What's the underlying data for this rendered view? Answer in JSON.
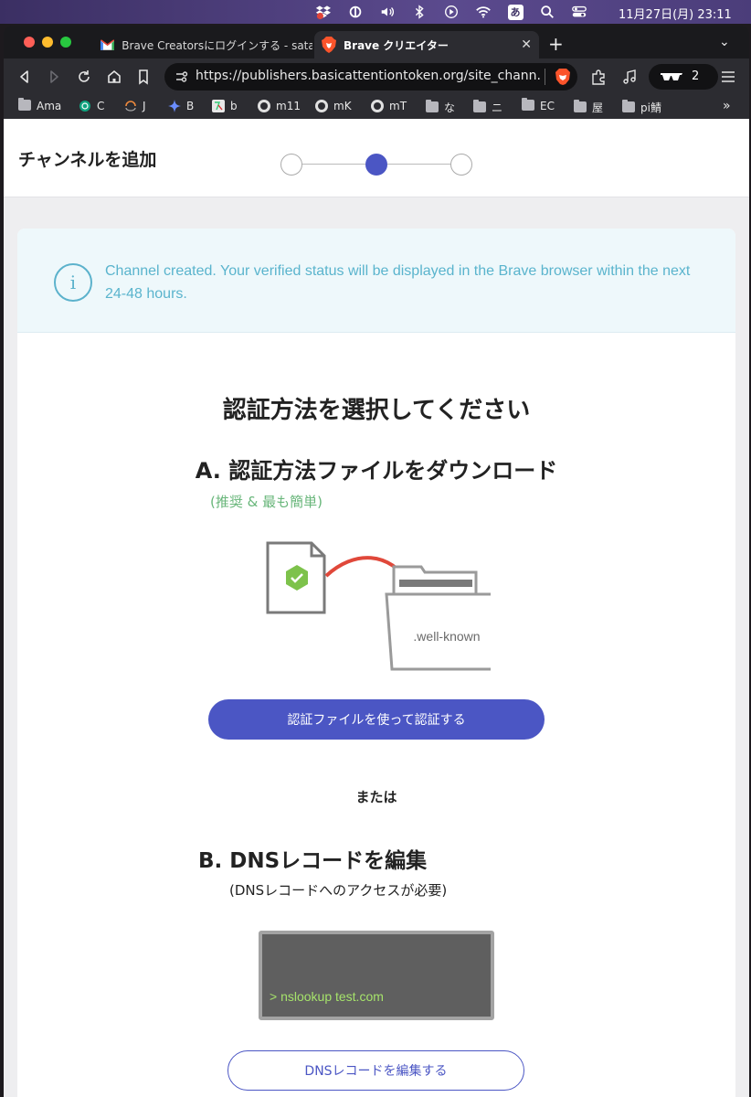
{
  "menubar": {
    "input_indicator": "あ",
    "datetime": "11月27日(月)  23:11",
    "icons": [
      "dropbox-icon",
      "1password-icon",
      "volume-icon",
      "bluetooth-icon",
      "play-icon",
      "wifi-icon",
      "input-method-icon",
      "spotlight-icon",
      "control-center-icon"
    ]
  },
  "browser": {
    "tabs": [
      {
        "title": "Brave Creatorsにログインする - satak",
        "favicon": "gmail-icon",
        "active": false
      },
      {
        "title": "Brave クリエイター",
        "favicon": "brave-icon",
        "active": true
      }
    ],
    "new_tab": "+",
    "url": "https://publishers.basicattentiontoken.org/site_chann...",
    "tor_count": "2",
    "bookmarks": [
      {
        "label": "Ama",
        "icon": "folder-icon"
      },
      {
        "label": "C",
        "icon": "chatgpt-icon"
      },
      {
        "label": "J",
        "icon": "ring-icon"
      },
      {
        "label": "B",
        "icon": "gemini-icon"
      },
      {
        "label": "b",
        "icon": "translate-icon"
      },
      {
        "label": "m11",
        "icon": "globe-icon"
      },
      {
        "label": "mK",
        "icon": "globe-icon"
      },
      {
        "label": "mT",
        "icon": "globe-icon"
      },
      {
        "label": "な",
        "icon": "folder-icon"
      },
      {
        "label": "ニ",
        "icon": "folder-icon"
      },
      {
        "label": "EC",
        "icon": "folder-icon"
      },
      {
        "label": "屋",
        "icon": "folder-icon"
      },
      {
        "label": "pi鯖",
        "icon": "folder-icon"
      }
    ],
    "bookmarks_more": "»"
  },
  "page": {
    "title": "チャンネルを追加",
    "steps_total": 3,
    "current_step": 2,
    "alert": "Channel created. Your verified status will be displayed in the Brave browser within the next 24-48 hours.",
    "heading": "認証方法を選択してください",
    "option_a": {
      "title": "A.  認証方法ファイルをダウンロード",
      "subtitle": "(推奨 & 最も簡単)",
      "folder_label": ".well-known",
      "button": "認証ファイルを使って認証する"
    },
    "or": "または",
    "option_b": {
      "title": "B.  DNSレコードを編集",
      "subtitle": "(DNSレコードへのアクセスが必要)",
      "terminal_command": "> nslookup test.com",
      "button": "DNSレコードを編集する"
    }
  },
  "colors": {
    "primary": "#4b56c4",
    "alert_text": "#5ab4cd",
    "recommended": "#68b67a",
    "terminal_text": "#a6e36b"
  }
}
